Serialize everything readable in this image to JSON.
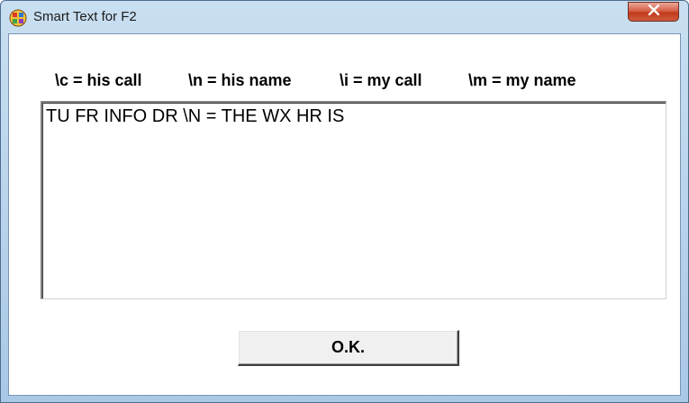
{
  "window": {
    "title": "Smart Text for F2",
    "close_label": "X"
  },
  "hints": {
    "his_call": "\\c = his call",
    "his_name": "\\n = his name",
    "my_call": "\\i = my call",
    "my_name": "\\m = my name"
  },
  "editor": {
    "value": "TU FR INFO DR \\N = THE WX HR IS"
  },
  "buttons": {
    "ok_label": "O.K."
  },
  "colors": {
    "titlebar": "#c9dff1",
    "close_button": "#c23a1d",
    "client_background": "#ffffff",
    "button_face": "#f0f0f0"
  },
  "icons": {
    "app": "colorful-grid-app-icon",
    "close": "close-icon"
  }
}
